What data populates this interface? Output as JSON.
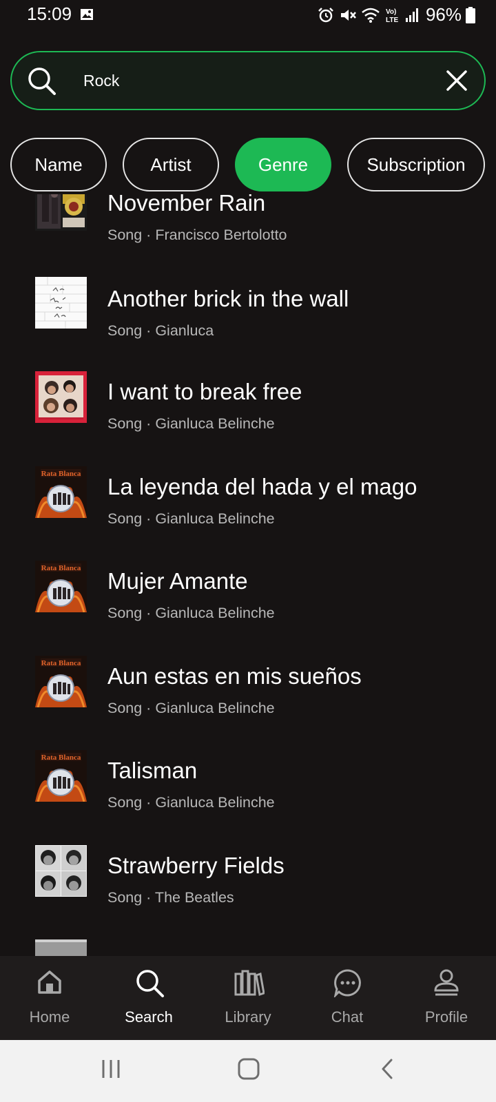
{
  "status_bar": {
    "time": "15:09",
    "battery": "96%",
    "icons": [
      "gallery-icon",
      "alarm-icon",
      "mute-icon",
      "wifi-icon",
      "volte-icon",
      "signal-icon",
      "battery-icon"
    ]
  },
  "search": {
    "value": "Rock",
    "placeholder": ""
  },
  "filters": [
    {
      "label": "Name",
      "active": false
    },
    {
      "label": "Artist",
      "active": false
    },
    {
      "label": "Genre",
      "active": true
    },
    {
      "label": "Subscription",
      "active": false
    }
  ],
  "results": [
    {
      "title": "November Rain",
      "subtitle": "Song · Francisco Bertolotto"
    },
    {
      "title": "Another brick in the wall",
      "subtitle": "Song · Gianluca"
    },
    {
      "title": "I want to break free",
      "subtitle": "Song · Gianluca Belinche"
    },
    {
      "title": "La leyenda del hada y el mago",
      "subtitle": "Song · Gianluca Belinche"
    },
    {
      "title": "Mujer Amante",
      "subtitle": "Song · Gianluca Belinche"
    },
    {
      "title": "Aun estas en mis sueños",
      "subtitle": "Song · Gianluca Belinche"
    },
    {
      "title": "Talisman",
      "subtitle": "Song · Gianluca Belinche"
    },
    {
      "title": "Strawberry Fields",
      "subtitle": "Song · The Beatles"
    }
  ],
  "bottom_nav": [
    {
      "label": "Home",
      "icon": "home-icon",
      "active": false
    },
    {
      "label": "Search",
      "icon": "search-icon",
      "active": true
    },
    {
      "label": "Library",
      "icon": "library-icon",
      "active": false
    },
    {
      "label": "Chat",
      "icon": "chat-icon",
      "active": false
    },
    {
      "label": "Profile",
      "icon": "profile-icon",
      "active": false
    }
  ],
  "colors": {
    "accent": "#1db954",
    "background": "#161313",
    "nav_background": "#1f1c1c"
  }
}
